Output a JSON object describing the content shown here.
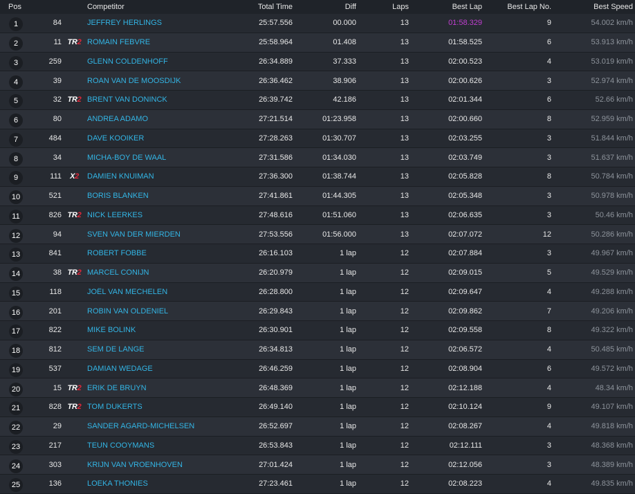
{
  "headers": {
    "pos": "Pos",
    "competitor": "Competitor",
    "total_time": "Total Time",
    "diff": "Diff",
    "laps": "Laps",
    "best_lap": "Best Lap",
    "best_lap_no": "Best Lap No.",
    "best_speed": "Best Speed"
  },
  "colors": {
    "name": "#33b5e5",
    "fastest_lap": "#c13fd1",
    "badge_red": "#e0283a",
    "background": "#23272e"
  },
  "rows": [
    {
      "pos": "1",
      "num": "84",
      "badge": "",
      "name": "JEFFREY HERLINGS",
      "total": "25:57.556",
      "diff": "00.000",
      "laps": "13",
      "best": "01:58.329",
      "best_no": "9",
      "speed": "54.002 km/h",
      "fastest": true
    },
    {
      "pos": "2",
      "num": "11",
      "badge": "TR2",
      "name": "ROMAIN FEBVRE",
      "total": "25:58.964",
      "diff": "01.408",
      "laps": "13",
      "best": "01:58.525",
      "best_no": "6",
      "speed": "53.913 km/h"
    },
    {
      "pos": "3",
      "num": "259",
      "badge": "",
      "name": "GLENN COLDENHOFF",
      "total": "26:34.889",
      "diff": "37.333",
      "laps": "13",
      "best": "02:00.523",
      "best_no": "4",
      "speed": "53.019 km/h"
    },
    {
      "pos": "4",
      "num": "39",
      "badge": "",
      "name": "ROAN VAN DE MOOSDIJK",
      "total": "26:36.462",
      "diff": "38.906",
      "laps": "13",
      "best": "02:00.626",
      "best_no": "3",
      "speed": "52.974 km/h"
    },
    {
      "pos": "5",
      "num": "32",
      "badge": "TR2",
      "name": "BRENT VAN DONINCK",
      "total": "26:39.742",
      "diff": "42.186",
      "laps": "13",
      "best": "02:01.344",
      "best_no": "6",
      "speed": "52.66 km/h"
    },
    {
      "pos": "6",
      "num": "80",
      "badge": "",
      "name": "ANDREA ADAMO",
      "total": "27:21.514",
      "diff": "01:23.958",
      "laps": "13",
      "best": "02:00.660",
      "best_no": "8",
      "speed": "52.959 km/h"
    },
    {
      "pos": "7",
      "num": "484",
      "badge": "",
      "name": "DAVE KOOIKER",
      "total": "27:28.263",
      "diff": "01:30.707",
      "laps": "13",
      "best": "02:03.255",
      "best_no": "3",
      "speed": "51.844 km/h"
    },
    {
      "pos": "8",
      "num": "34",
      "badge": "",
      "name": "MICHA-BOY DE WAAL",
      "total": "27:31.586",
      "diff": "01:34.030",
      "laps": "13",
      "best": "02:03.749",
      "best_no": "3",
      "speed": "51.637 km/h"
    },
    {
      "pos": "9",
      "num": "111",
      "badge": "X2",
      "name": "DAMIEN KNUIMAN",
      "total": "27:36.300",
      "diff": "01:38.744",
      "laps": "13",
      "best": "02:05.828",
      "best_no": "8",
      "speed": "50.784 km/h"
    },
    {
      "pos": "10",
      "num": "521",
      "badge": "",
      "name": "BORIS BLANKEN",
      "total": "27:41.861",
      "diff": "01:44.305",
      "laps": "13",
      "best": "02:05.348",
      "best_no": "3",
      "speed": "50.978 km/h"
    },
    {
      "pos": "11",
      "num": "826",
      "badge": "TR2",
      "name": "NICK LEERKES",
      "total": "27:48.616",
      "diff": "01:51.060",
      "laps": "13",
      "best": "02:06.635",
      "best_no": "3",
      "speed": "50.46 km/h"
    },
    {
      "pos": "12",
      "num": "94",
      "badge": "",
      "name": "SVEN VAN DER MIERDEN",
      "total": "27:53.556",
      "diff": "01:56.000",
      "laps": "13",
      "best": "02:07.072",
      "best_no": "12",
      "speed": "50.286 km/h"
    },
    {
      "pos": "13",
      "num": "841",
      "badge": "",
      "name": "ROBERT FOBBE",
      "total": "26:16.103",
      "diff": "1 lap",
      "laps": "12",
      "best": "02:07.884",
      "best_no": "3",
      "speed": "49.967 km/h"
    },
    {
      "pos": "14",
      "num": "38",
      "badge": "TR2",
      "name": "MARCEL CONIJN",
      "total": "26:20.979",
      "diff": "1 lap",
      "laps": "12",
      "best": "02:09.015",
      "best_no": "5",
      "speed": "49.529 km/h"
    },
    {
      "pos": "15",
      "num": "118",
      "badge": "",
      "name": "JOËL VAN MECHELEN",
      "total": "26:28.800",
      "diff": "1 lap",
      "laps": "12",
      "best": "02:09.647",
      "best_no": "4",
      "speed": "49.288 km/h"
    },
    {
      "pos": "16",
      "num": "201",
      "badge": "",
      "name": "ROBIN VAN OLDENIEL",
      "total": "26:29.843",
      "diff": "1 lap",
      "laps": "12",
      "best": "02:09.862",
      "best_no": "7",
      "speed": "49.206 km/h"
    },
    {
      "pos": "17",
      "num": "822",
      "badge": "",
      "name": "MIKE BOLINK",
      "total": "26:30.901",
      "diff": "1 lap",
      "laps": "12",
      "best": "02:09.558",
      "best_no": "8",
      "speed": "49.322 km/h"
    },
    {
      "pos": "18",
      "num": "812",
      "badge": "",
      "name": "SEM DE LANGE",
      "total": "26:34.813",
      "diff": "1 lap",
      "laps": "12",
      "best": "02:06.572",
      "best_no": "4",
      "speed": "50.485 km/h"
    },
    {
      "pos": "19",
      "num": "537",
      "badge": "",
      "name": "DAMIAN WEDAGE",
      "total": "26:46.259",
      "diff": "1 lap",
      "laps": "12",
      "best": "02:08.904",
      "best_no": "6",
      "speed": "49.572 km/h"
    },
    {
      "pos": "20",
      "num": "15",
      "badge": "TR2",
      "name": "ERIK DE BRUYN",
      "total": "26:48.369",
      "diff": "1 lap",
      "laps": "12",
      "best": "02:12.188",
      "best_no": "4",
      "speed": "48.34 km/h"
    },
    {
      "pos": "21",
      "num": "828",
      "badge": "TR2",
      "name": "TOM DUKERTS",
      "total": "26:49.140",
      "diff": "1 lap",
      "laps": "12",
      "best": "02:10.124",
      "best_no": "9",
      "speed": "49.107 km/h"
    },
    {
      "pos": "22",
      "num": "29",
      "badge": "",
      "name": "SANDER AGARD-MICHELSEN",
      "total": "26:52.697",
      "diff": "1 lap",
      "laps": "12",
      "best": "02:08.267",
      "best_no": "4",
      "speed": "49.818 km/h"
    },
    {
      "pos": "23",
      "num": "217",
      "badge": "",
      "name": "TEUN COOYMANS",
      "total": "26:53.843",
      "diff": "1 lap",
      "laps": "12",
      "best": "02:12.111",
      "best_no": "3",
      "speed": "48.368 km/h"
    },
    {
      "pos": "24",
      "num": "303",
      "badge": "",
      "name": "KRIJN VAN VROENHOVEN",
      "total": "27:01.424",
      "diff": "1 lap",
      "laps": "12",
      "best": "02:12.056",
      "best_no": "3",
      "speed": "48.389 km/h"
    },
    {
      "pos": "25",
      "num": "136",
      "badge": "",
      "name": "LOEKA THONIES",
      "total": "27:23.461",
      "diff": "1 lap",
      "laps": "12",
      "best": "02:08.223",
      "best_no": "4",
      "speed": "49.835 km/h"
    }
  ]
}
